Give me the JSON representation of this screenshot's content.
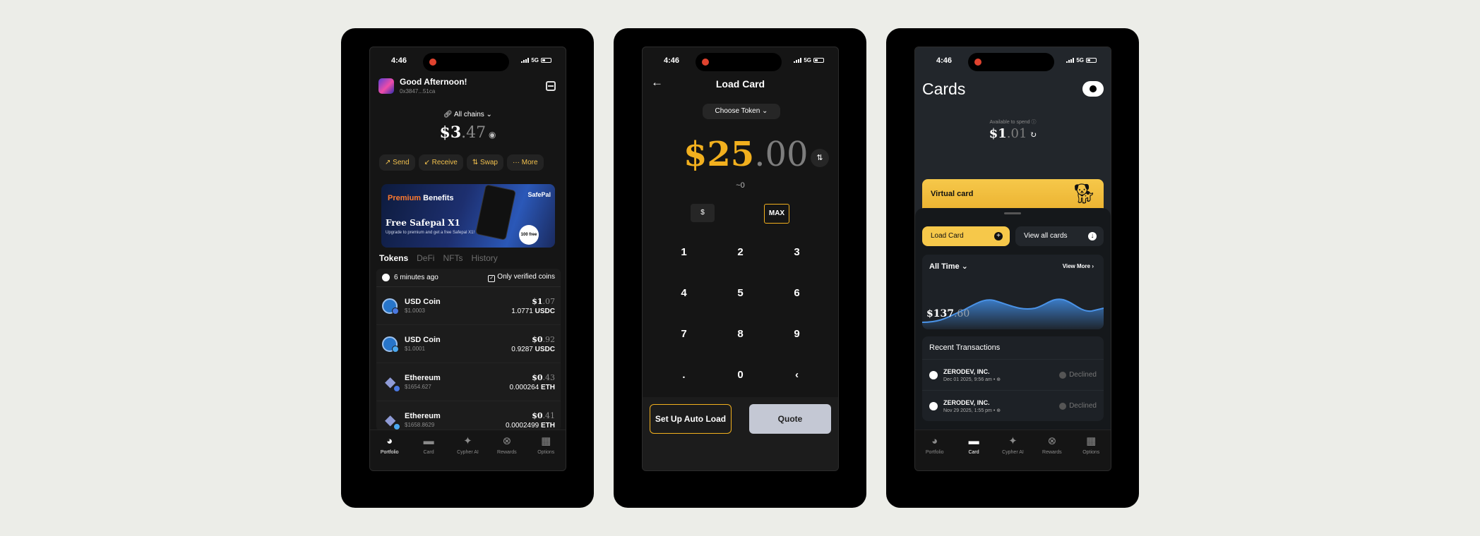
{
  "status": {
    "time": "4:46",
    "network": "5G"
  },
  "nav": {
    "portfolio": "Portfolio",
    "card": "Card",
    "cypher_ai": "Cypher AI",
    "rewards": "Rewards",
    "options": "Options"
  },
  "portfolio": {
    "greeting": "Good Afternoon!",
    "address": "0x3847...51ca",
    "chains_label": "All chains",
    "balance_int": "$3",
    "balance_dec": ".47",
    "actions": {
      "send": "↗ Send",
      "receive": "↙ Receive",
      "swap": "⇅ Swap",
      "more": "··· More"
    },
    "banner": {
      "premium": "Premium",
      "benefits": "Benefits",
      "title": "Free Safepal X1",
      "subtitle": "Upgrade to premium and get a free Safepal X1!",
      "brand": "SafePal",
      "seal": "100 free"
    },
    "tabs": {
      "tokens": "Tokens",
      "defi": "DeFi",
      "nfts": "NFTs",
      "history": "History"
    },
    "updated": "6 minutes ago",
    "verified_label": "Only verified coins",
    "tokens": [
      {
        "name": "USD Coin",
        "price": "$1.0003",
        "value_int": "$1",
        "value_dec": ".07",
        "qty": "1.0771",
        "symbol": "USDC"
      },
      {
        "name": "USD Coin",
        "price": "$1.0001",
        "value_int": "$0",
        "value_dec": ".92",
        "qty": "0.9287",
        "symbol": "USDC"
      },
      {
        "name": "Ethereum",
        "price": "$1654.627",
        "value_int": "$0",
        "value_dec": ".43",
        "qty": "0.000264",
        "symbol": "ETH"
      },
      {
        "name": "Ethereum",
        "price": "$1658.8629",
        "value_int": "$0",
        "value_dec": ".41",
        "qty": "0.0002499",
        "symbol": "ETH"
      }
    ]
  },
  "load": {
    "title": "Load Card",
    "choose_token": "Choose Token",
    "amount_int": "$25",
    "amount_dec": ".00",
    "approx": "~0",
    "currency_btn": "$",
    "max_btn": "MAX",
    "keys": [
      "1",
      "2",
      "3",
      "4",
      "5",
      "6",
      "7",
      "8",
      "9",
      ".",
      "0",
      "‹"
    ],
    "auto_load": "Set Up Auto Load",
    "quote": "Quote"
  },
  "cards": {
    "title": "Cards",
    "available_label": "Available to spend",
    "balance_int": "$1",
    "balance_dec": ".01",
    "virtual_card": "Virtual card",
    "load_card": "Load Card",
    "view_all": "View all cards",
    "period": "All Time",
    "view_more": "View More",
    "spend_int": "$137",
    "spend_dec": ".60",
    "recent_title": "Recent Transactions",
    "transactions": [
      {
        "merchant": "ZERODEV, INC.",
        "date": "Dec 01 2025, 9:56 am",
        "status": "Declined"
      },
      {
        "merchant": "ZERODEV, INC.",
        "date": "Nov 29 2025, 1:55 pm",
        "status": "Declined"
      }
    ]
  },
  "colors": {
    "accent": "#f2b01e",
    "card_yellow": "#f6c84a",
    "chart_blue": "#3f86d8"
  }
}
